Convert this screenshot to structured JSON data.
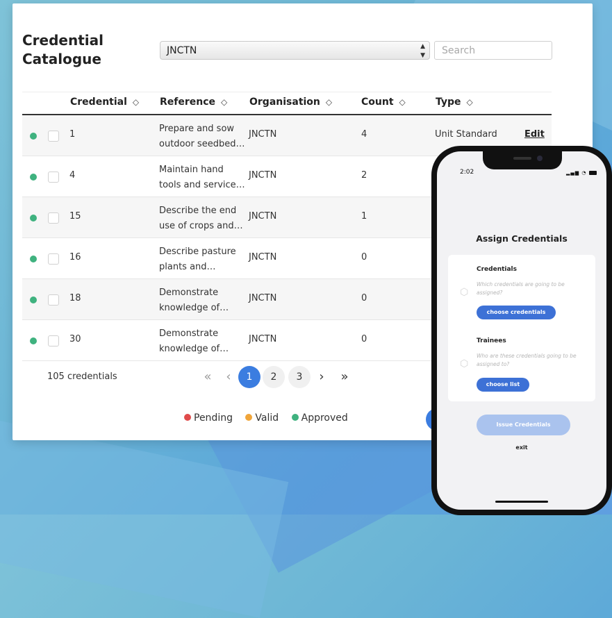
{
  "page": {
    "title_line1": "Credential",
    "title_line2": "Catalogue",
    "organisation_select": "JNCTN",
    "search_placeholder": "Search"
  },
  "table": {
    "columns": [
      "Credential",
      "Reference",
      "Organisation",
      "Count",
      "Type"
    ],
    "rows": [
      {
        "status": "approved",
        "credential": "1",
        "ref1": "Prepare and sow",
        "ref2": "outdoor seedbed…",
        "organisation": "JNCTN",
        "count": "4",
        "type": "Unit Standard",
        "action": "Edit"
      },
      {
        "status": "approved",
        "credential": "4",
        "ref1": "Maintain hand",
        "ref2": "tools and service…",
        "organisation": "JNCTN",
        "count": "2"
      },
      {
        "status": "approved",
        "credential": "15",
        "ref1": "Describe the end",
        "ref2": "use of crops and…",
        "organisation": "JNCTN",
        "count": "1"
      },
      {
        "status": "approved",
        "credential": "16",
        "ref1": "Describe pasture",
        "ref2": "plants and…",
        "organisation": "JNCTN",
        "count": "0"
      },
      {
        "status": "approved",
        "credential": "18",
        "ref1": "Demonstrate",
        "ref2": "knowledge of…",
        "organisation": "JNCTN",
        "count": "0"
      },
      {
        "status": "approved",
        "credential": "30",
        "ref1": "Demonstrate",
        "ref2": "knowledge of…",
        "organisation": "JNCTN",
        "count": "0"
      }
    ]
  },
  "footer": {
    "total": "105 credentials",
    "pagination": {
      "first": "«",
      "prev": "‹",
      "pages": [
        "1",
        "2",
        "3"
      ],
      "current": "1",
      "next": "›",
      "last": "»"
    },
    "legend": [
      {
        "label": "Pending",
        "color": "#e04b4b"
      },
      {
        "label": "Valid",
        "color": "#f0a53a"
      },
      {
        "label": "Approved",
        "color": "#3fb27f"
      }
    ]
  },
  "colors": {
    "approved": "#3fb27f",
    "accent": "#3b7de0"
  },
  "phone": {
    "time": "2:02",
    "title": "Assign Credentials",
    "credentials_label": "Credentials",
    "credentials_hint": "Which credentials are going to be assigned?",
    "credentials_button": "choose credentials",
    "trainees_label": "Trainees",
    "trainees_hint": "Who are these credentials going to be assigned to?",
    "trainees_button": "choose list",
    "issue_button": "Issue Credentials",
    "exit": "exit"
  }
}
